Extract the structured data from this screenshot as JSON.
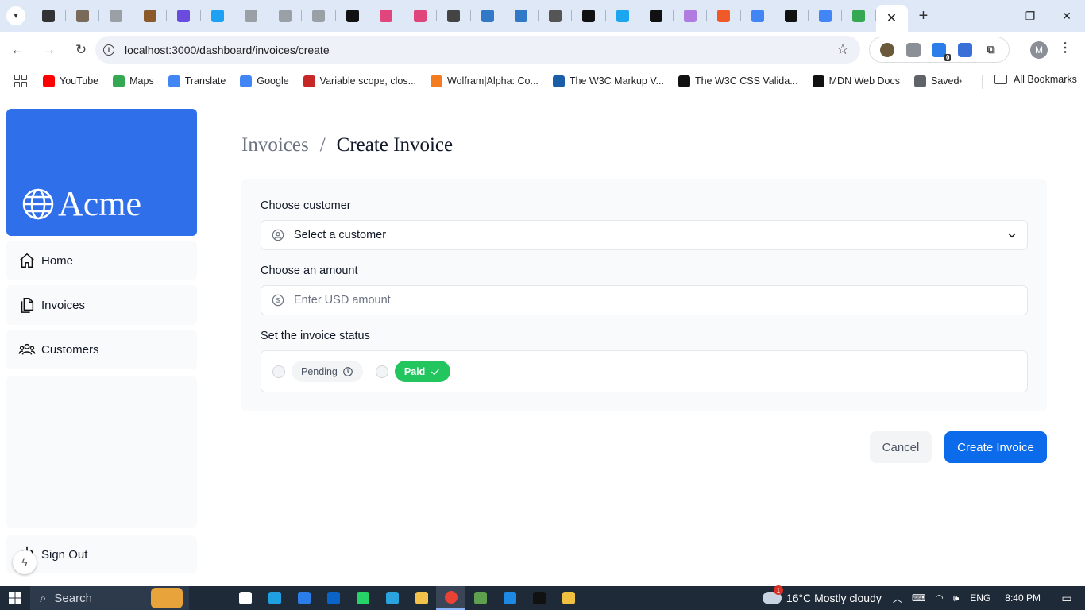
{
  "browser": {
    "tabs": [
      {
        "icon": "box-icon",
        "color": "#333333"
      },
      {
        "icon": "pattern-icon",
        "color": "#7a6a5a"
      },
      {
        "icon": "github-icon",
        "color": "#9aa0a6"
      },
      {
        "icon": "crown-icon",
        "color": "#8a5a2a"
      },
      {
        "icon": "pen-icon",
        "color": "#6a4adf"
      },
      {
        "icon": "bird-icon",
        "color": "#1da1f2"
      },
      {
        "icon": "globe-grey-icon",
        "color": "#9aa0a6"
      },
      {
        "icon": "globe-grey-icon",
        "color": "#9aa0a6"
      },
      {
        "icon": "globe-grey-icon",
        "color": "#9aa0a6"
      },
      {
        "icon": "hashnode-icon",
        "color": "#111111"
      },
      {
        "icon": "colorwheel-icon",
        "color": "#e0457b"
      },
      {
        "icon": "colorwheel-icon",
        "color": "#e0457b"
      },
      {
        "icon": "gear-icon",
        "color": "#444444"
      },
      {
        "icon": "typescript-icon",
        "color": "#3178c6"
      },
      {
        "icon": "typescript-icon",
        "color": "#3178c6"
      },
      {
        "icon": "doc-icon",
        "color": "#555555"
      },
      {
        "icon": "upwork-icon",
        "color": "#111111"
      },
      {
        "icon": "circle-blue-icon",
        "color": "#1ba6ef"
      },
      {
        "icon": "triangle-icon",
        "color": "#111111"
      },
      {
        "icon": "mail-icon",
        "color": "#b07cdf"
      },
      {
        "icon": "brand-orange-icon",
        "color": "#f05a28"
      },
      {
        "icon": "google-icon",
        "color": "#4285f4"
      },
      {
        "icon": "triangle-icon",
        "color": "#111111"
      },
      {
        "icon": "google-icon",
        "color": "#4285f4"
      },
      {
        "icon": "drive-icon",
        "color": "#34a853"
      }
    ],
    "active_tab_close": "✕",
    "new_tab": "+",
    "url": "localhost:3000/dashboard/invoices/create",
    "profile_initial": "M",
    "extension_badge": "0",
    "bookmarks": [
      {
        "label": "YouTube",
        "color": "#ff0000",
        "icon": "youtube-icon"
      },
      {
        "label": "Maps",
        "color": "#34a853",
        "icon": "maps-pin-icon"
      },
      {
        "label": "Translate",
        "color": "#4285f4",
        "icon": "translate-icon"
      },
      {
        "label": "Google",
        "color": "#4285f4",
        "icon": "google-icon"
      },
      {
        "label": "Variable scope, clos...",
        "color": "#c62828",
        "icon": "antenna-icon"
      },
      {
        "label": "Wolfram|Alpha: Co...",
        "color": "#f47c20",
        "icon": "wolfram-icon"
      },
      {
        "label": "The W3C Markup V...",
        "color": "#1a5ea8",
        "icon": "w3c-icon"
      },
      {
        "label": "The W3C CSS Valida...",
        "color": "#111111",
        "icon": "css-validator-icon"
      },
      {
        "label": "MDN Web Docs",
        "color": "#111111",
        "icon": "mdn-icon"
      },
      {
        "label": "Saved",
        "color": "#5f6368",
        "icon": "globe-icon"
      }
    ],
    "all_bookmarks": "All Bookmarks",
    "overflow": "»"
  },
  "sidebar": {
    "logo_text": "Acme",
    "links": [
      {
        "label": "Home",
        "icon": "home-icon"
      },
      {
        "label": "Invoices",
        "icon": "documents-icon"
      },
      {
        "label": "Customers",
        "icon": "users-icon"
      }
    ],
    "sign_out": "Sign Out"
  },
  "breadcrumb": {
    "parent": "Invoices",
    "separator": "/",
    "current": "Create Invoice"
  },
  "form": {
    "customer_label": "Choose customer",
    "customer_value": "Select a customer",
    "amount_label": "Choose an amount",
    "amount_placeholder": "Enter USD amount",
    "status_label": "Set the invoice status",
    "status_options": [
      {
        "label": "Pending",
        "selected": false
      },
      {
        "label": "Paid",
        "selected": false
      }
    ],
    "cancel": "Cancel",
    "submit": "Create Invoice"
  },
  "colors": {
    "brand": "#2f6fea",
    "primary_button": "#0b6bea",
    "paid_green": "#22c55e"
  },
  "taskbar": {
    "search": "Search",
    "apps": [
      {
        "icon": "task-view-icon",
        "color": "#ffffff"
      },
      {
        "icon": "edge-icon",
        "color": "#1fa0e0"
      },
      {
        "icon": "store-icon",
        "color": "#2b7de9"
      },
      {
        "icon": "outlook-icon",
        "color": "#0a64c8"
      },
      {
        "icon": "whatsapp-icon",
        "color": "#25d366"
      },
      {
        "icon": "telegram-icon",
        "color": "#2aa3df"
      },
      {
        "icon": "file-explorer-icon",
        "color": "#f3c24a"
      },
      {
        "icon": "chrome-icon",
        "color": "#ea4335"
      },
      {
        "icon": "node-icon",
        "color": "#5fa04e"
      },
      {
        "icon": "vscode-icon",
        "color": "#1e88e5"
      },
      {
        "icon": "terminal-icon",
        "color": "#111111"
      },
      {
        "icon": "git-icon",
        "color": "#f0c040"
      }
    ],
    "weather": "16°C  Mostly cloudy",
    "language": "ENG",
    "time": "8:40 PM"
  }
}
